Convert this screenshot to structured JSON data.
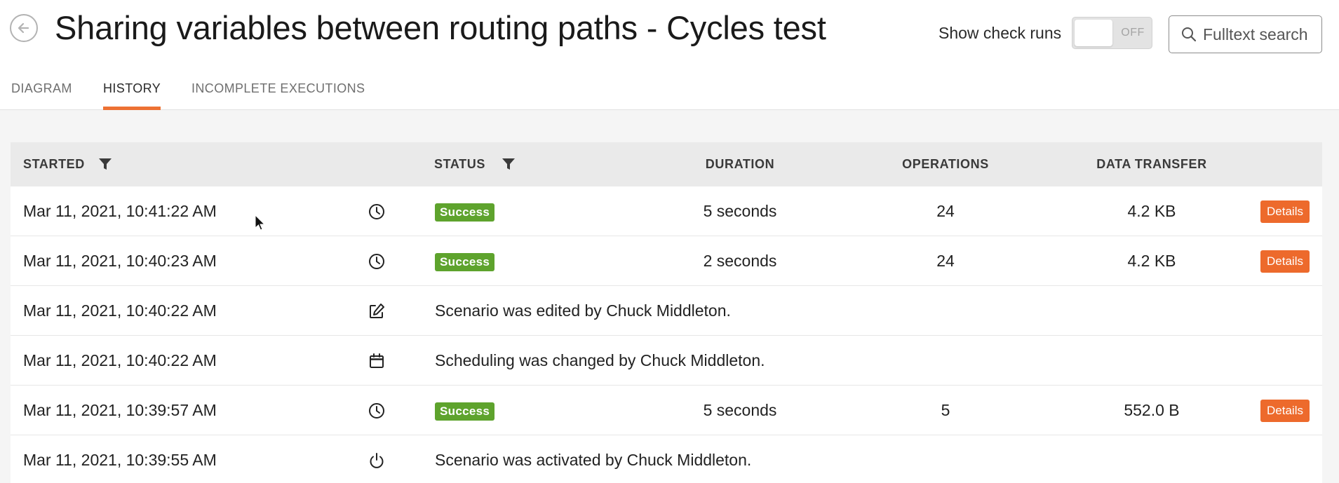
{
  "header": {
    "title": "Sharing variables between routing paths - Cycles test",
    "check_runs_label": "Show check runs",
    "toggle_state": "OFF",
    "search_label": "Fulltext search"
  },
  "tabs": [
    {
      "label": "DIAGRAM",
      "active": false
    },
    {
      "label": "HISTORY",
      "active": true
    },
    {
      "label": "INCOMPLETE EXECUTIONS",
      "active": false
    }
  ],
  "table": {
    "columns": {
      "started": "STARTED",
      "status": "STATUS",
      "duration": "DURATION",
      "operations": "OPERATIONS",
      "data_transfer": "DATA TRANSFER"
    },
    "rows": [
      {
        "started": "Mar 11, 2021, 10:41:22 AM",
        "icon": "clock-icon",
        "status": "Success",
        "duration": "5 seconds",
        "operations": "24",
        "data_transfer": "4.2 KB",
        "details": "Details"
      },
      {
        "started": "Mar 11, 2021, 10:40:23 AM",
        "icon": "clock-icon",
        "status": "Success",
        "duration": "2 seconds",
        "operations": "24",
        "data_transfer": "4.2 KB",
        "details": "Details"
      },
      {
        "started": "Mar 11, 2021, 10:40:22 AM",
        "icon": "edit-icon",
        "message": "Scenario was edited by Chuck Middleton."
      },
      {
        "started": "Mar 11, 2021, 10:40:22 AM",
        "icon": "calendar-icon",
        "message": "Scheduling was changed by Chuck Middleton."
      },
      {
        "started": "Mar 11, 2021, 10:39:57 AM",
        "icon": "clock-icon",
        "status": "Success",
        "duration": "5 seconds",
        "operations": "5",
        "data_transfer": "552.0 B",
        "details": "Details"
      },
      {
        "started": "Mar 11, 2021, 10:39:55 AM",
        "icon": "power-icon",
        "message": "Scenario was activated by Chuck Middleton."
      }
    ]
  },
  "colors": {
    "accent": "#ed7133",
    "success": "#5ea32d",
    "details_button": "#ed6a2c"
  }
}
